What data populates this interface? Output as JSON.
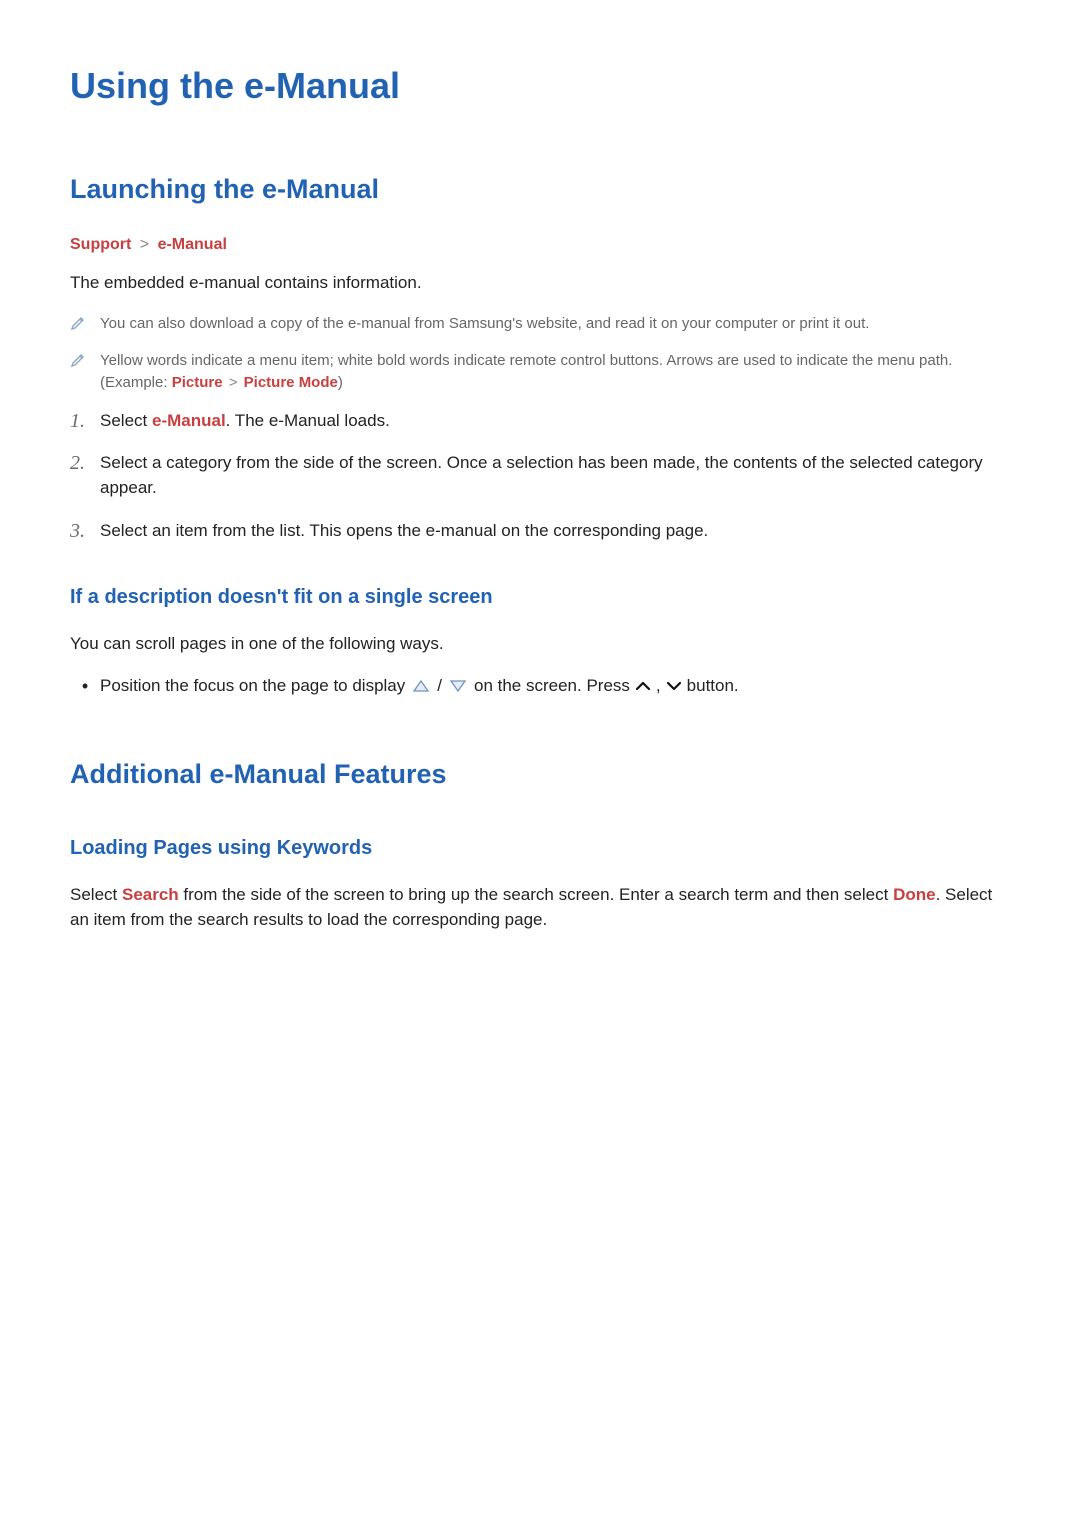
{
  "title": "Using the e-Manual",
  "s1": {
    "heading": "Launching the e-Manual",
    "crumb1": "Support",
    "crumb2": "e-Manual",
    "intro": "The embedded e-manual contains information.",
    "note1": "You can also download a copy of the e-manual from Samsung's website, and read it on your computer or print it out.",
    "note2_a": "Yellow words indicate a menu item; white bold words indicate remote control buttons. Arrows are used to indicate the menu path. (Example: ",
    "note2_p": "Picture",
    "note2_pm": "Picture Mode",
    "note2_z": ")",
    "step1_a": "Select ",
    "step1_em": "e-Manual",
    "step1_b": ". The e-Manual loads.",
    "step2": "Select a category from the side of the screen. Once a selection has been made, the contents of the selected category appear.",
    "step3": "Select an item from the list. This opens the e-manual on the corresponding page.",
    "sub_heading": "If a description doesn't fit on a single screen",
    "sub_para": "You can scroll pages in one of the following ways.",
    "bullet_a": "Position the focus on the page to display ",
    "bullet_b": " / ",
    "bullet_c": " on the screen. Press ",
    "bullet_d": ", ",
    "bullet_e": " button."
  },
  "s2": {
    "heading": "Additional e-Manual Features",
    "sub_heading": "Loading Pages using Keywords",
    "para_a": "Select ",
    "para_search": "Search",
    "para_b": " from the side of the screen to bring up the search screen. Enter a search term and then select ",
    "para_done": "Done",
    "para_c": ". Select an item from the search results to load the corresponding page."
  }
}
